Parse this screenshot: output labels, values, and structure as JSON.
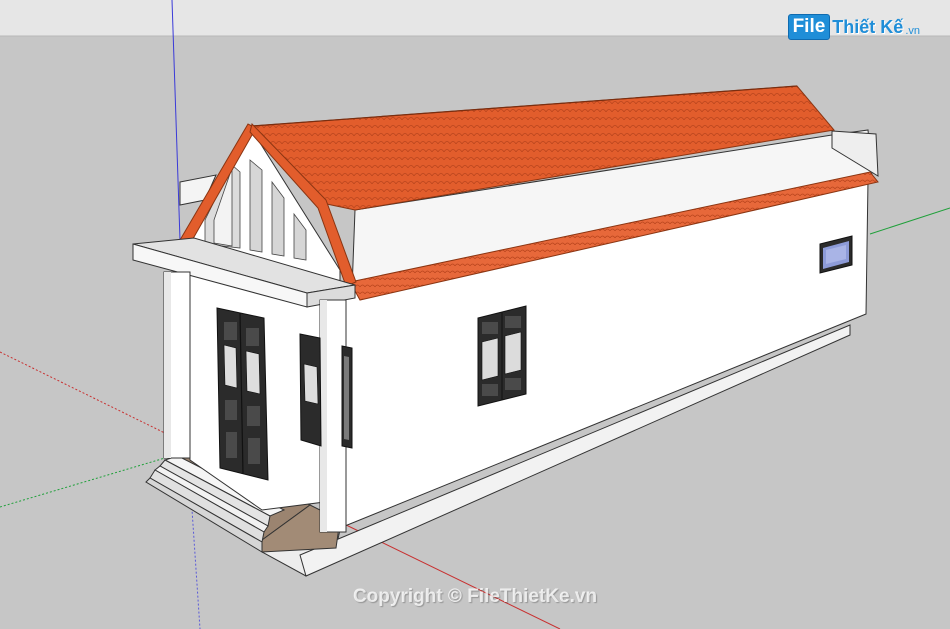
{
  "logo": {
    "file_text": "File",
    "brand_text": "Thiết Kế",
    "tld_text": ".vn"
  },
  "watermark": {
    "text": "Copyright © FileThietKe.vn"
  },
  "colors": {
    "sky": "#e6e6e6",
    "ground": "#c6c6c6",
    "wall": "#ffffff",
    "roof_tile": "#e25d2c",
    "roof_edge": "#c44a20",
    "frame_dark": "#2b2b2b",
    "axis_blue": "#3a3ad8",
    "axis_green": "#1fa03a",
    "axis_red": "#c83030",
    "brand_blue": "#1f8ed8"
  },
  "icons": {
    "logo": "filethietke-logo"
  }
}
